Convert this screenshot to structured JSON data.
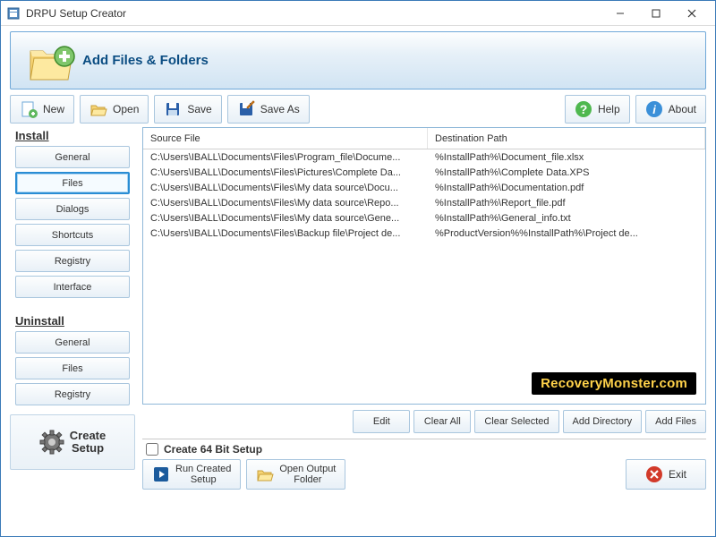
{
  "window": {
    "title": "DRPU Setup Creator"
  },
  "header": {
    "title": "Add Files & Folders"
  },
  "toolbar": {
    "new": "New",
    "open": "Open",
    "save": "Save",
    "saveas": "Save As",
    "help": "Help",
    "about": "About"
  },
  "sidebar": {
    "install_title": "Install",
    "install_items": [
      {
        "label": "General"
      },
      {
        "label": "Files",
        "selected": true
      },
      {
        "label": "Dialogs"
      },
      {
        "label": "Shortcuts"
      },
      {
        "label": "Registry"
      },
      {
        "label": "Interface"
      }
    ],
    "uninstall_title": "Uninstall",
    "uninstall_items": [
      {
        "label": "General"
      },
      {
        "label": "Files"
      },
      {
        "label": "Registry"
      }
    ],
    "create_setup": "Create\nSetup"
  },
  "table": {
    "col1": "Source File",
    "col2": "Destination Path",
    "rows": [
      {
        "src": "C:\\Users\\IBALL\\Documents\\Files\\Program_file\\Docume...",
        "dst": "%InstallPath%\\Document_file.xlsx"
      },
      {
        "src": "C:\\Users\\IBALL\\Documents\\Files\\Pictures\\Complete Da...",
        "dst": "%InstallPath%\\Complete Data.XPS"
      },
      {
        "src": "C:\\Users\\IBALL\\Documents\\Files\\My data source\\Docu...",
        "dst": "%InstallPath%\\Documentation.pdf"
      },
      {
        "src": "C:\\Users\\IBALL\\Documents\\Files\\My data source\\Repo...",
        "dst": "%InstallPath%\\Report_file.pdf"
      },
      {
        "src": "C:\\Users\\IBALL\\Documents\\Files\\My data source\\Gene...",
        "dst": "%InstallPath%\\General_info.txt"
      },
      {
        "src": "C:\\Users\\IBALL\\Documents\\Files\\Backup file\\Project de...",
        "dst": "%ProductVersion%%InstallPath%\\Project de..."
      }
    ]
  },
  "watermark": "RecoveryMonster.com",
  "actions": {
    "edit": "Edit",
    "clear_all": "Clear All",
    "clear_selected": "Clear Selected",
    "add_directory": "Add Directory",
    "add_files": "Add Files"
  },
  "bottom": {
    "checkbox": "Create 64 Bit Setup",
    "run": "Run Created\nSetup",
    "open_output": "Open Output\nFolder",
    "exit": "Exit"
  }
}
